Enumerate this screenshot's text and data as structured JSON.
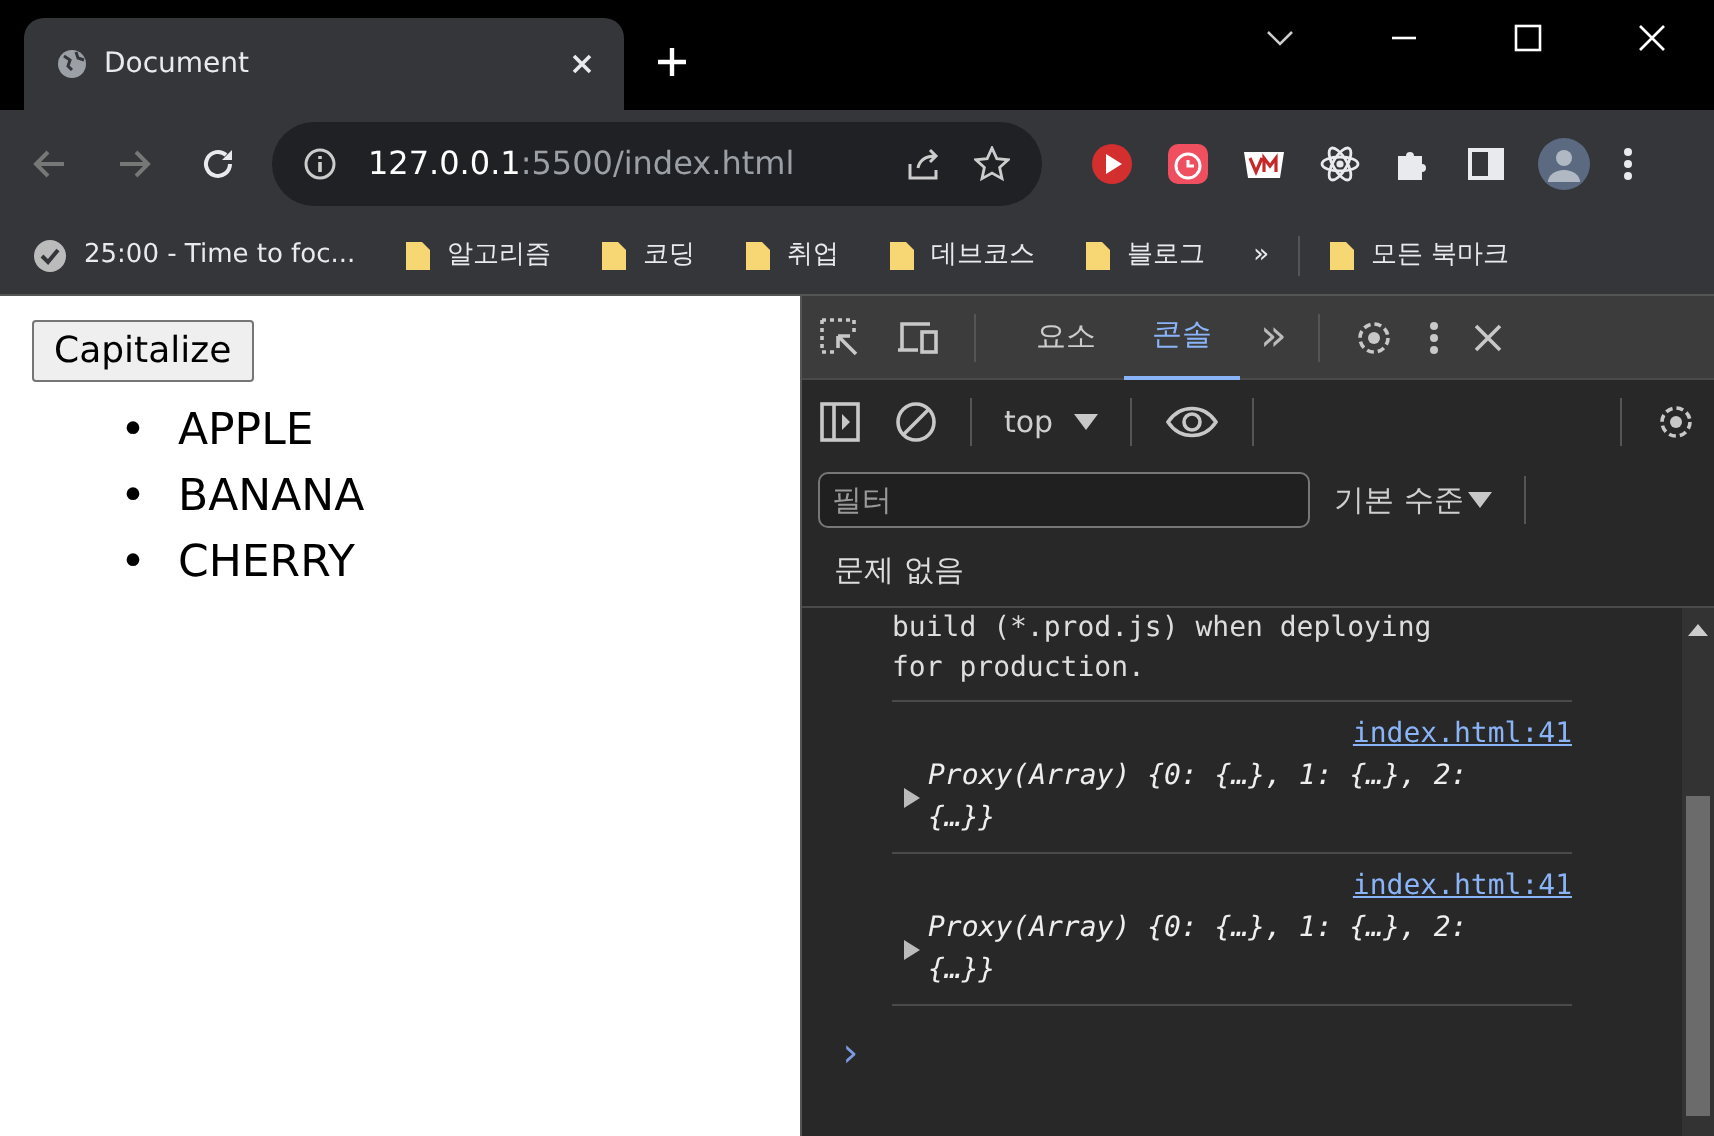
{
  "browser": {
    "tab_title": "Document",
    "address": {
      "host": "127.0.0.1",
      "rest": ":5500/index.html"
    },
    "bookmarks": [
      {
        "label": "25:00 - Time to foc...",
        "kind": "site"
      },
      {
        "label": "알고리즘",
        "kind": "folder"
      },
      {
        "label": "코딩",
        "kind": "folder"
      },
      {
        "label": "취업",
        "kind": "folder"
      },
      {
        "label": "데브코스",
        "kind": "folder"
      },
      {
        "label": "블로그",
        "kind": "folder"
      }
    ],
    "overflow": "»",
    "all_bookmarks": "모든 북마크"
  },
  "page": {
    "button": "Capitalize",
    "items": [
      {
        "marker": "•",
        "text": "APPLE"
      },
      {
        "marker": "•",
        "text": "BANANA"
      },
      {
        "marker": "•",
        "text": "CHERRY"
      }
    ]
  },
  "devtools": {
    "tabs": [
      {
        "label": "요소",
        "selected": false
      },
      {
        "label": "콘솔",
        "selected": true
      }
    ],
    "more": "»",
    "context": "top",
    "filter": {
      "placeholder": "필터"
    },
    "levels": "기본 수준",
    "issues": "문제 없음",
    "messages": [
      {
        "kind": "text",
        "text": "build (*.prod.js) when deploying\nfor production."
      },
      {
        "kind": "object",
        "source": "index.html:41",
        "text": "Proxy(Array) {0: {…}, 1: {…}, 2: {…}}"
      },
      {
        "kind": "object",
        "source": "index.html:41",
        "text": "Proxy(Array) {0: {…}, 1: {…}, 2: {…}}"
      }
    ],
    "prompt": "›"
  }
}
